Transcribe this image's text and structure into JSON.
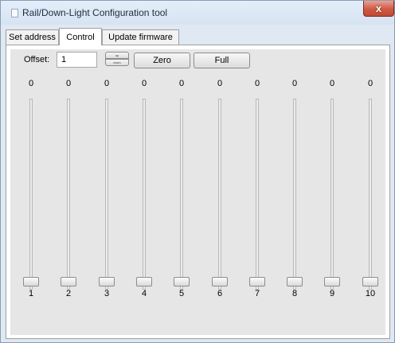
{
  "window": {
    "title": "Rail/Down-Light Configuration tool",
    "close_glyph": "x"
  },
  "tabs": [
    {
      "label": "Set address",
      "active": false
    },
    {
      "label": "Control",
      "active": true
    },
    {
      "label": "Update firmware",
      "active": false
    }
  ],
  "control": {
    "offset_label": "Offset:",
    "offset_value": "1",
    "spin_up_label": "up",
    "spin_down_label": "down",
    "zero_button": "Zero",
    "full_button": "Full",
    "channels": [
      {
        "label": "1",
        "value": "0",
        "level": 0
      },
      {
        "label": "2",
        "value": "0",
        "level": 0
      },
      {
        "label": "3",
        "value": "0",
        "level": 0
      },
      {
        "label": "4",
        "value": "0",
        "level": 0
      },
      {
        "label": "5",
        "value": "0",
        "level": 0
      },
      {
        "label": "6",
        "value": "0",
        "level": 0
      },
      {
        "label": "7",
        "value": "0",
        "level": 0
      },
      {
        "label": "8",
        "value": "0",
        "level": 0
      },
      {
        "label": "9",
        "value": "0",
        "level": 0
      },
      {
        "label": "10",
        "value": "0",
        "level": 0
      }
    ]
  },
  "colors": {
    "titlebar": "#dfe8f3",
    "close_button": "#c9503a",
    "panel_background": "#e6e6e6"
  }
}
